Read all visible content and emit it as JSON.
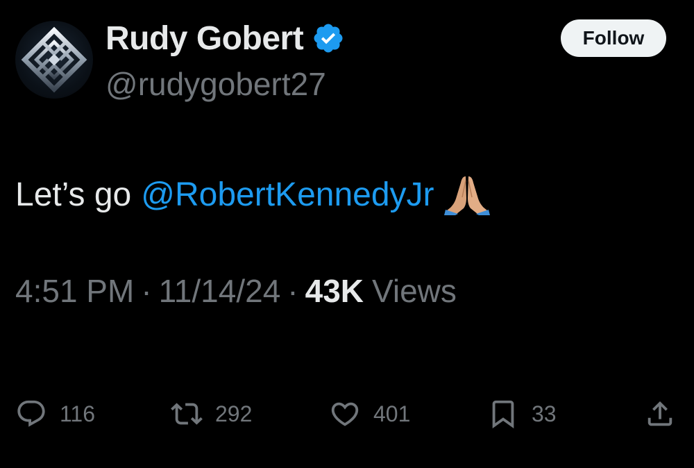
{
  "user": {
    "display_name": "Rudy Gobert",
    "handle": "@rudygobert27",
    "verified": true,
    "avatar_icon": "silver-diamond-knot-logo"
  },
  "follow_label": "Follow",
  "tweet": {
    "text": "Let’s go",
    "mention": "@RobertKennedyJr",
    "emoji": "folded-hands-emoji"
  },
  "meta": {
    "time": "4:51 PM",
    "separator": "·",
    "date": "11/14/24",
    "views_count": "43K",
    "views_label": "Views"
  },
  "actions": {
    "replies": "116",
    "reposts": "292",
    "likes": "401",
    "bookmarks": "33"
  },
  "colors": {
    "background": "#000000",
    "text_primary": "#e7e9ea",
    "text_secondary": "#71767b",
    "accent_blue": "#1d9bf0",
    "follow_bg": "#eff3f4"
  }
}
